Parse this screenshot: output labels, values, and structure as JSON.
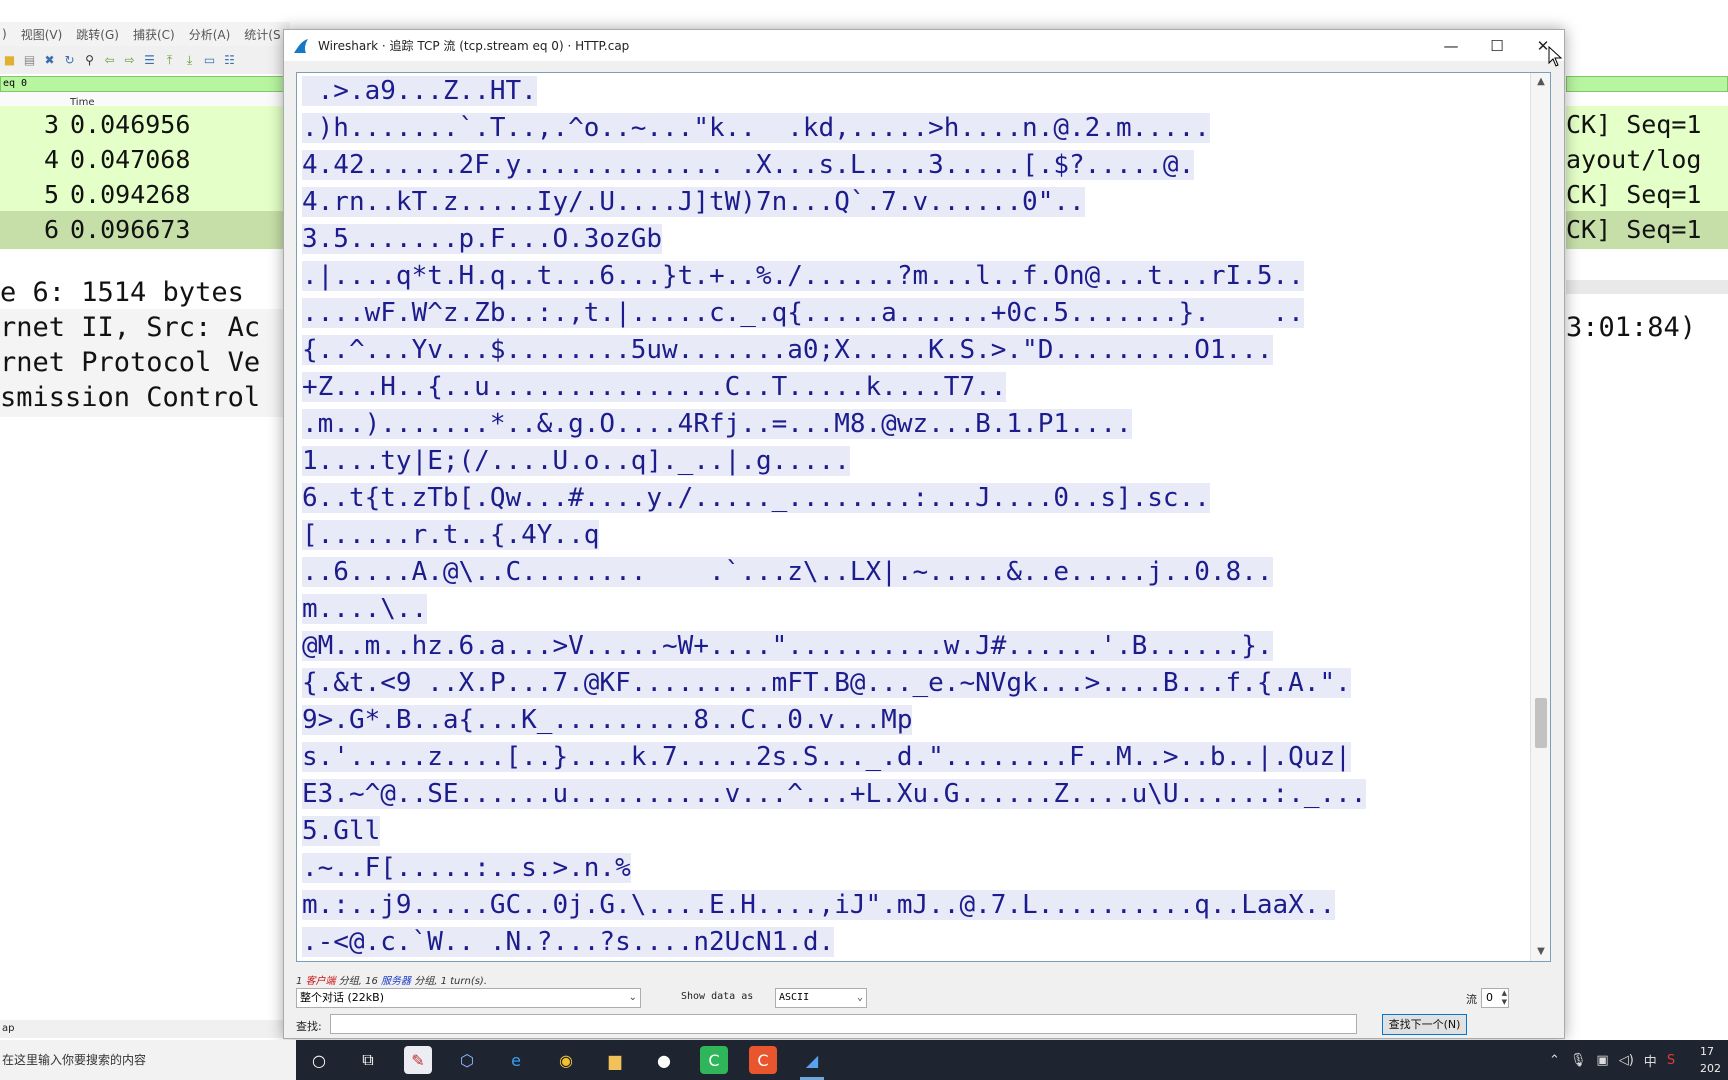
{
  "bg_window": {
    "menus": [
      ")",
      "视图(V)",
      "跳转(G)",
      "捕获(C)",
      "分析(A)",
      "统计(S"
    ],
    "filter_text": "eq 0",
    "column_time": "Time",
    "rows": [
      {
        "no": "3",
        "time": "0.046956",
        "right": "CK] Seq=1"
      },
      {
        "no": "4",
        "time": "0.047068",
        "right": "ayout/log"
      },
      {
        "no": "5",
        "time": "0.094268",
        "right": "CK] Seq=1"
      },
      {
        "no": "6",
        "time": "0.096673",
        "right": "CK] Seq=1"
      }
    ],
    "details": [
      "e 6: 1514 bytes",
      "rnet II, Src: Ac",
      "rnet Protocol Ve",
      "smission Control"
    ],
    "detail_right": "3:01:84)",
    "status": "ap"
  },
  "dialog": {
    "title": "Wireshark · 追踪 TCP 流 (tcp.stream eq 0) · HTTP.cap",
    "stream_lines": [
      " .>.a9...Z..HT.",
      ".)h.......`.T..,.^o..~...\"k..  .kd,.....>h....n.@.2.m.....",
      "4.42......2F.y............. .X...s.L....3.....[.$?.....@.",
      "4.rn..kT.z.....Iy/.U....J]tW)7n...Q`.7.v......0\"..",
      "3.5.......p.F...O.3ozGb",
      ".|....q*t.H.q..t...6...}t.+..%./......?m...l..f.On@...t...rI.5..",
      "....wF.W^z.Zb..:.,t.|.....c._.q{.....a......+0c.5.......}.    ..",
      "{..^...Yv...$........5uw.......a0;X.....K.S.>.\"D.........O1...",
      "+Z...H..{..u...............C..T.....k....T7..",
      ".m..).......*..&.g.O....4Rfj..=...M8.@wz...B.1.P1....",
      "1....ty|E;(/....U.o..q]._..|.g.....",
      "6..t{t.zTb[.Qw...#....y./....._........:...J....0..s].sc..",
      "[......r.t..{.4Y..q",
      "..6....A.@\\..C........    .`...z\\..LX|.~.....&..e.....j..0.8..",
      "m....\\..",
      "@M..m..hz.6.a...>V.....~W+....\"..........w.J#......'.B......}.",
      "{.&t.<9 ..X.P...7.@KF.........mFT.B@..._e.~NVgk...>....B...f.{.A.\".",
      "9>.G*.B..a{...K_.........8..C..0.v...Mp",
      "s.'.....z....[..}....k.7.....2s.S..._.d.\"........F..M..>..b..|.Quz|",
      "E3.~^@..SE......u..........v...^...+L.Xu.G......Z....u\\U......:._...",
      "5.Gll",
      ".~..F[.....:..s.>.n.%",
      "m.:..j9.....GC..0j.G.\\....E.H....,iJ\".mJ..@.7.L..........q..LaaX..",
      ".-<@.c.`W.. .N.?...?s....n2UcN1.d."
    ],
    "summary": {
      "clients_count": "1",
      "clients_label": "客户端",
      "sep1": " 分组, ",
      "servers_count": "16",
      "servers_label": "服务器",
      "sep2": " 分组, 1 turn(s)."
    },
    "conversation_select": "整个对话 (22kB)",
    "show_data_label": "Show data as",
    "show_data_value": "ASCII",
    "stream_label": "流",
    "stream_value": "0",
    "find_label": "查找:",
    "find_value": "",
    "find_next_label": "查找下一个(N)"
  },
  "taskbar": {
    "search_placeholder": "在这里输入你要搜索的内容",
    "tray_ime": "中",
    "clock_time": "17",
    "clock_date": "202"
  }
}
